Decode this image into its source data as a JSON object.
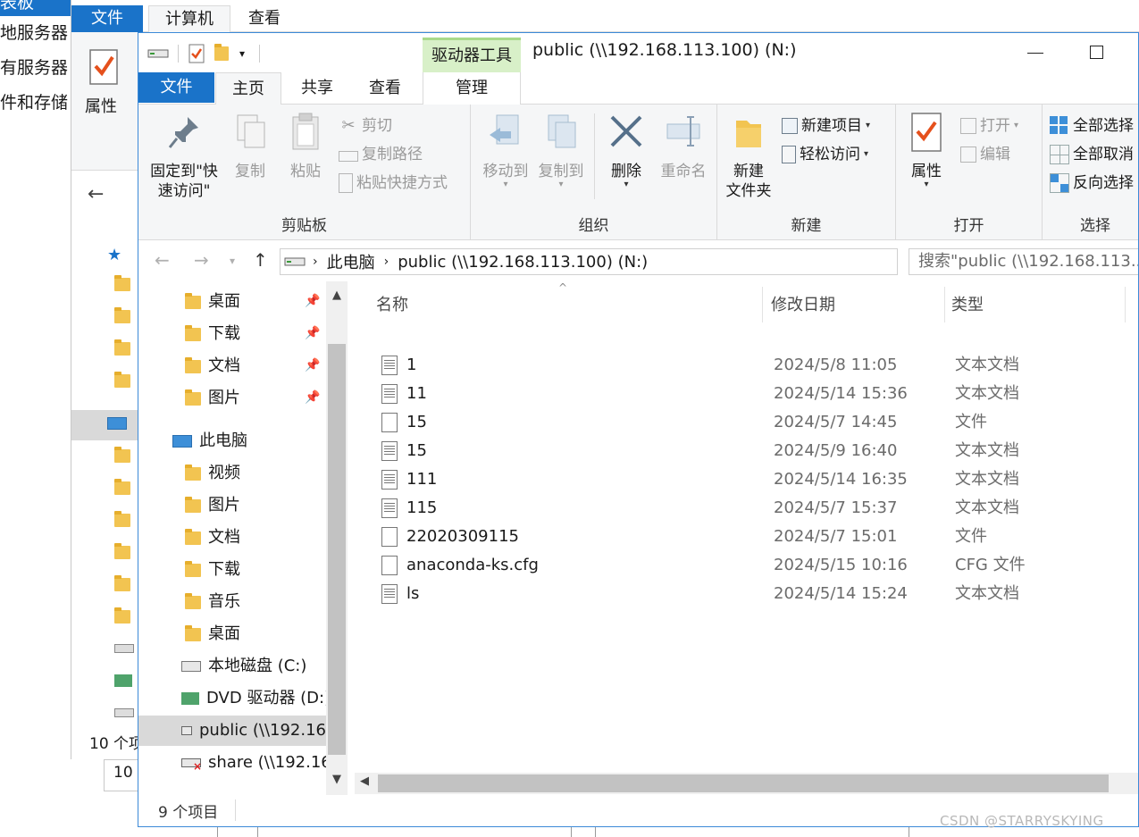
{
  "background": {
    "sidebar": [
      "表板",
      "地服务器",
      "有服务器",
      "件和存储"
    ],
    "tabs": [
      "文件",
      "计算机",
      "查看"
    ],
    "properties_label": "属性",
    "status_items": "10 个项",
    "lower_label": "10"
  },
  "window": {
    "title": "public (\\\\192.168.113.100) (N:)",
    "context_tab_group": "驱动器工具",
    "tabs": {
      "file": "文件",
      "home": "主页",
      "share": "共享",
      "view": "查看",
      "manage": "管理"
    }
  },
  "ribbon": {
    "clipboard": {
      "label": "剪贴板",
      "pin": "固定到\"快\n速访问\"",
      "copy": "复制",
      "paste": "粘贴",
      "cut": "剪切",
      "copy_path": "复制路径",
      "paste_shortcut": "粘贴快捷方式"
    },
    "organize": {
      "label": "组织",
      "move_to": "移动到",
      "copy_to": "复制到",
      "delete": "删除",
      "rename": "重命名"
    },
    "new": {
      "label": "新建",
      "new_folder": "新建\n文件夹",
      "new_item": "新建项目",
      "easy_access": "轻松访问"
    },
    "open": {
      "label": "打开",
      "properties": "属性",
      "open": "打开",
      "edit": "编辑"
    },
    "select": {
      "label": "选择",
      "select_all": "全部选择",
      "select_none": "全部取消",
      "invert": "反向选择"
    }
  },
  "address": {
    "crumbs": [
      "此电脑",
      "public (\\\\192.168.113.100) (N:)"
    ],
    "search_placeholder": "搜索\"public (\\\\192.168.113...."
  },
  "nav": {
    "quick": [
      {
        "label": "桌面"
      },
      {
        "label": "下载"
      },
      {
        "label": "文档"
      },
      {
        "label": "图片"
      }
    ],
    "this_pc": "此电脑",
    "pc_items": [
      {
        "label": "视频"
      },
      {
        "label": "图片"
      },
      {
        "label": "文档"
      },
      {
        "label": "下载"
      },
      {
        "label": "音乐"
      },
      {
        "label": "桌面"
      }
    ],
    "drives": [
      {
        "label": "本地磁盘 (C:)"
      },
      {
        "label": "DVD 驱动器 (D:)"
      },
      {
        "label": "public (\\\\192.16"
      },
      {
        "label": "share (\\\\192.16"
      }
    ]
  },
  "columns": {
    "name": "名称",
    "date": "修改日期",
    "type": "类型"
  },
  "files": [
    {
      "name": "1",
      "date": "2024/5/8 11:05",
      "type": "文本文档"
    },
    {
      "name": "11",
      "date": "2024/5/14 15:36",
      "type": "文本文档"
    },
    {
      "name": "15",
      "date": "2024/5/7 14:45",
      "type": "文件"
    },
    {
      "name": "15",
      "date": "2024/5/9 16:40",
      "type": "文本文档"
    },
    {
      "name": "111",
      "date": "2024/5/14 16:35",
      "type": "文本文档"
    },
    {
      "name": "115",
      "date": "2024/5/7 15:37",
      "type": "文本文档"
    },
    {
      "name": "22020309115",
      "date": "2024/5/7 15:01",
      "type": "文件"
    },
    {
      "name": "anaconda-ks.cfg",
      "date": "2024/5/15 10:16",
      "type": "CFG 文件"
    },
    {
      "name": "ls",
      "date": "2024/5/14 15:24",
      "type": "文本文档"
    }
  ],
  "status": "9 个项目",
  "watermark": "CSDN @STARRYSKYING"
}
